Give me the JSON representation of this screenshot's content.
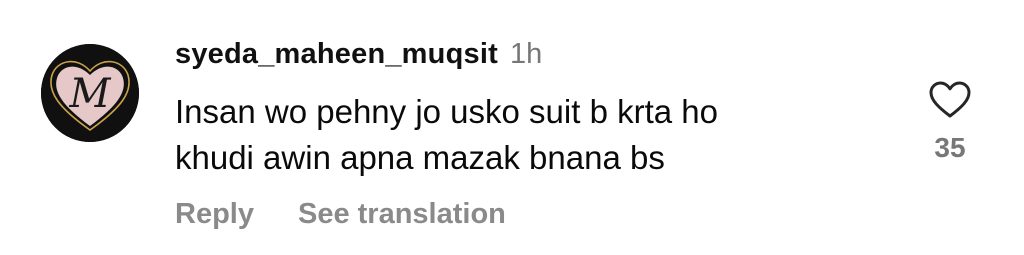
{
  "comment": {
    "avatar_letter": "M",
    "username": "syeda_maheen_muqsit",
    "timestamp": "1h",
    "text_lines": [
      "Insan wo pehny jo usko suit b krta ho",
      "khudi awin apna mazak bnana bs"
    ]
  },
  "actions": {
    "reply_label": "Reply",
    "translate_label": "See translation"
  },
  "like": {
    "icon": "heart-outline-icon",
    "count": "35"
  },
  "colors": {
    "username": "#111111",
    "meta_gray": "#777777",
    "action_gray": "#8a8a8a",
    "avatar_bg": "#101010",
    "avatar_heart": "#f3d6d6",
    "avatar_gold": "#c9a24a"
  }
}
